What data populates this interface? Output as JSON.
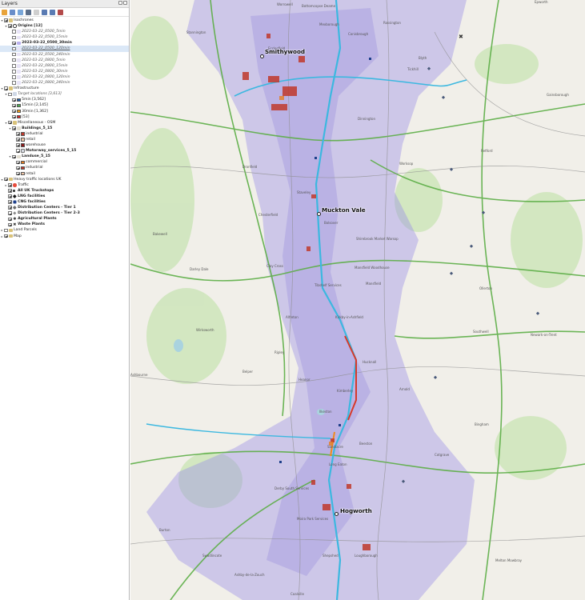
{
  "panel": {
    "title": "Layers"
  },
  "layers": {
    "isochrones": "Isochrones",
    "origins": "Origins [12]",
    "o1": "2023-03-22_0500_5min",
    "o2": "2023-03-22_0500_15min",
    "o3": "2023-03-22_0500_30min",
    "o4": "2023-03-22_0500_120min",
    "o5": "2023-03-22_0500_240min",
    "o6": "2023-03-22_0800_5min",
    "o7": "2023-03-22_0800_15min",
    "o8": "2023-03-22_0800_30min",
    "o9": "2023-03-22_0800_120min",
    "o10": "2023-03-22_0800_240min",
    "infrastructure": "Infrastructure",
    "targets": "Target locations [3,613]",
    "t5": "5min [3,562]",
    "t15": "15min [2,145]",
    "t30": "30min [1,362]",
    "t53": "[53]",
    "misc": "Miscellaneous - OSM",
    "buildings": "Buildings_5_15",
    "industrial": "industrial",
    "retail": "retail",
    "warehouse": "warehouse",
    "motorway": "Motorway_services_5_15",
    "landuse": "Landuse_5_15",
    "commercial": "commercial",
    "lu_industrial": "industrial",
    "lu_retail": "retail",
    "heavy": "Heavy traffic locations UK",
    "traffic": "Traffic",
    "truckstops": "All UK Truckstops",
    "lng": "LNG facilities",
    "cng": "CNG facilities",
    "dc1": "Distribution Centers - Tier 1",
    "dc23": "Distribution Centers - Tier 2-3",
    "agri": "Agricultural Plants",
    "waste": "Waste Plants",
    "parcels": "Land Parcels",
    "map": "Map"
  },
  "colors": {
    "t5": "#1f5fa8",
    "t15": "#4caf50",
    "t30": "#f39c12",
    "t53": "#d62728",
    "industrial": "#c0392b",
    "retail": "#f1c7a7",
    "warehouse": "#8b1a1a",
    "commercial": "#e67e22",
    "isochrone": "#9a8fe6",
    "road_main": "#2ca02c",
    "motorway": "#3cb8e0"
  },
  "map": {
    "towns": {
      "smithywood": "Smithywood",
      "muckton_vale": "Muckton Vale",
      "hogworth": "Hogworth"
    },
    "labels": {
      "worrowell": "Worrowell",
      "bottomcopse": "Bottomcopse Deame",
      "stannington": "Stannington",
      "mexborough": "Mexborough",
      "conisbrough": "Conisbrough",
      "ecclesfield": "Ecclesfield",
      "rossington": "Rossington",
      "epworth": "Epworth",
      "blyth": "Blyth",
      "tickhill": "Tickhill",
      "gainsborough": "Gainsborough",
      "dinnington": "Dinnington",
      "retford": "Retford",
      "dronfield": "Dronfield",
      "worksop": "Worksop",
      "staveley": "Staveley",
      "chesterfield": "Chesterfield",
      "bolsover": "Bolsover",
      "bakewell": "Bakewell",
      "shirebrook": "Shirebrook Market Warsop",
      "clay_cross": "Clay Cross",
      "mansfield_wh": "Mansfield Woodhouse",
      "darley_dale": "Darley Dale",
      "mansfield": "Mansfield",
      "tibshelf": "Tibshelf Services",
      "alfreton": "Alfreton",
      "kirkby": "Kirkby-in-Ashfield",
      "ollerton": "Ollerton",
      "southwell": "Southwell",
      "newark": "Newark-on-Trent",
      "wirksworth": "Wirksworth",
      "ripley": "Ripley",
      "hucknall": "Hucknall",
      "belper": "Belper",
      "heanor": "Heanor",
      "kimberley": "Kimberley",
      "arnold": "Arnold",
      "ilkeston": "Ilkeston",
      "ashbourne": "Ashbourne",
      "bingham": "Bingham",
      "beeston": "Beeston",
      "sandiacre": "Sandiacre",
      "long_eaton": "Long Eaton",
      "cotgrave": "Cotgrave",
      "derby_south": "Derby South Services",
      "burton": "Burton",
      "swadlincote": "Swadlincote",
      "moira": "Moira Park Services",
      "shepshed": "Shepshed",
      "loughborough": "Loughborough",
      "melton": "Melton Mowbray",
      "ashby": "Ashby-de-la-Zouch",
      "coalville": "Coalville"
    }
  }
}
